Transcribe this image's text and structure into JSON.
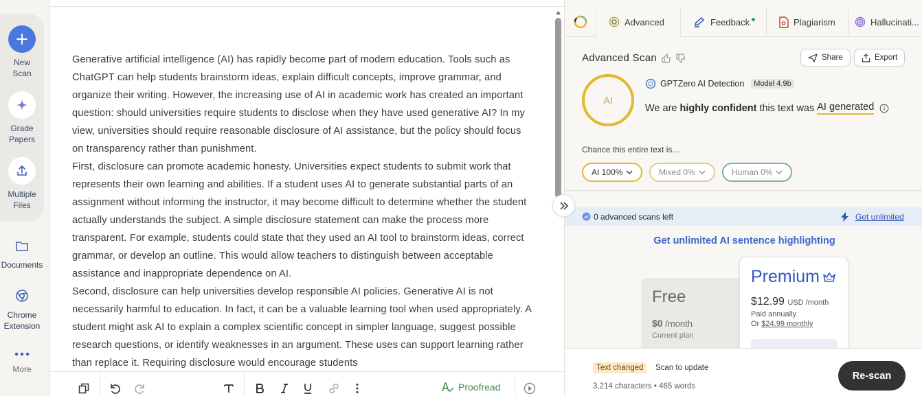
{
  "sidebar": {
    "items": [
      {
        "label_1": "New",
        "label_2": "Scan",
        "icon": "plus-icon"
      },
      {
        "label_1": "Grade",
        "label_2": "Papers",
        "icon": "sparkle-icon"
      },
      {
        "label_1": "Multiple",
        "label_2": "Files",
        "icon": "upload-icon"
      },
      {
        "label": "Documents",
        "icon": "folder-icon"
      },
      {
        "label_1": "Chrome",
        "label_2": "Extension",
        "icon": "chrome-icon"
      },
      {
        "label": "More",
        "icon": "more-dots-icon"
      }
    ]
  },
  "document": {
    "paragraphs": [
      "Generative artificial intelligence (AI) has rapidly become part of modern education. Tools such as ChatGPT can help students brainstorm ideas, explain difficult concepts, improve grammar, and organize their writing. However, the increasing use of AI in academic work has created an important question: should universities require students to disclose when they have used generative AI? In my view, universities should require reasonable disclosure of AI assistance, but the policy should focus on transparency rather than punishment.",
      "First, disclosure can promote academic honesty. Universities expect students to submit work that represents their own learning and abilities. If a student uses AI to generate substantial parts of an assignment without informing the instructor, it may become difficult to determine whether the student actually understands the subject. A simple disclosure statement can make the process more transparent. For example, students could state that they used an AI tool to brainstorm ideas, correct grammar, or develop an outline. This would allow teachers to distinguish between acceptable assistance and inappropriate dependence on AI.",
      "Second, disclosure can help universities develop responsible AI policies. Generative AI is not necessarily harmful to education. In fact, it can be a valuable learning tool when used appropriately. A student might ask AI to explain a complex scientific concept in simpler language, suggest possible research questions, or identify weaknesses in an argument. These uses can support learning rather than replace it. Requiring disclosure would encourage students"
    ]
  },
  "toolbar": {
    "proofread_label": "Proofread"
  },
  "tabs": [
    {
      "label": "Advanced",
      "icon": "advanced-scan-icon"
    },
    {
      "label": "Feedback",
      "icon": "feedback-pen-icon"
    },
    {
      "label": "Plagiarism",
      "icon": "plagiarism-doc-icon"
    },
    {
      "label": "Hallucinati...",
      "icon": "hallucination-spiral-icon"
    }
  ],
  "scan": {
    "title": "Advanced Scan",
    "share_label": "Share",
    "export_label": "Export",
    "ring_label": "AI",
    "detector_name": "GPTZero AI Detection",
    "model_badge": "Model 4.9b",
    "verdict_1": "We are",
    "verdict_bold": "highly confident",
    "verdict_2": "this text was",
    "verdict_ai": "AI generated",
    "chance_label": "Chance this entire text is...",
    "pills": [
      {
        "label": "AI 100%",
        "color": "#e5b72e",
        "text_color": "#2b2b2b"
      },
      {
        "label": "Mixed 0%",
        "color": "#d9cf9c",
        "text_color": "#8a8a8a"
      },
      {
        "label": "Human 0%",
        "color": "#7fb39a",
        "text_color": "#8a8a8a"
      }
    ]
  },
  "upsell": {
    "scans_left": "0 advanced scans left",
    "get_unlimited": "Get unlimited",
    "headline": "Get unlimited AI sentence highlighting",
    "free": {
      "name": "Free",
      "price": "$0",
      "period": "/month",
      "plan": "Current plan"
    },
    "premium": {
      "name": "Premium",
      "price": "$12.99",
      "currency_period": "USD /month",
      "billing": "Paid annually",
      "or_label": "Or",
      "monthly": "$24.99 monthly"
    }
  },
  "footer": {
    "changed_badge": "Text changed",
    "scan_to_update": "Scan to update",
    "counts": "3,214 characters • 465 words",
    "rescan_label": "Re-scan"
  },
  "colors": {
    "accent_blue": "#4a78e0",
    "ai_yellow": "#e5b72e",
    "human_green": "#7fb39a",
    "premium_blue": "#2f58c6"
  }
}
